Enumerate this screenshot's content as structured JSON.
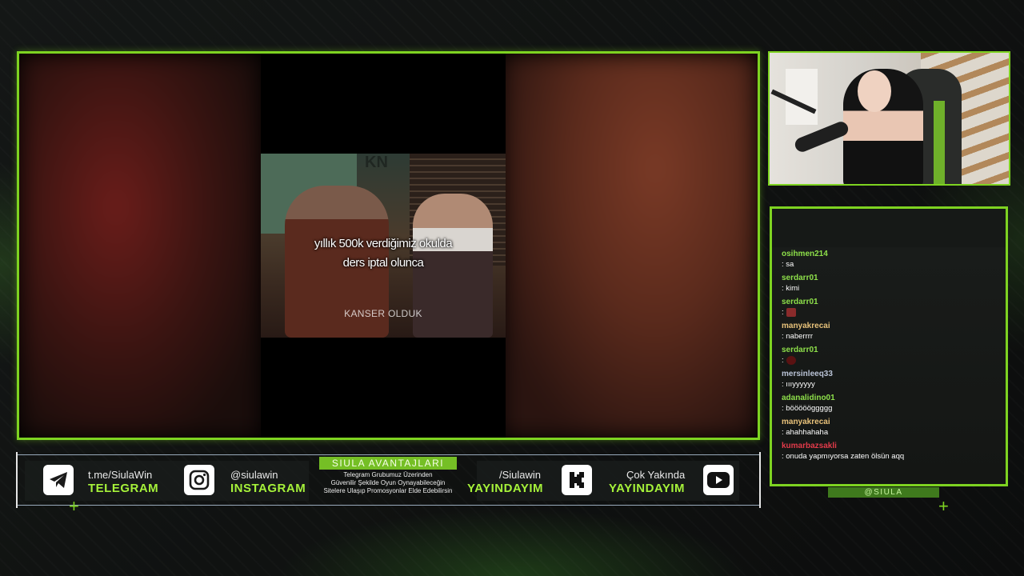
{
  "video": {
    "caption_line1": "yıllık 500k verdiğimiz okulda",
    "caption_line2": "ders iptal olunca",
    "watermark": "KANSER OLDUK",
    "channel_logo": "KN"
  },
  "socials": [
    {
      "icon": "telegram-icon",
      "handle": "t.me/SiulaWin",
      "label": "TELEGRAM"
    },
    {
      "icon": "instagram-icon",
      "handle": "@siulawin",
      "label": "INSTAGRAM"
    },
    {
      "icon": "kick-icon",
      "handle": "/Siulawin",
      "label": "YAYINDAYIM"
    },
    {
      "icon": "youtube-icon",
      "handle": "Çok Yakında",
      "label": "YAYINDAYIM"
    }
  ],
  "advantages": {
    "title": "SIULA AVANTAJLARI",
    "line1": "Telegram Grubumuz Üzerinden",
    "line2": "Güvenilir Şekilde Oyun Oynayabileceğin",
    "line3": "Sitelere Ulaşıp Promosyonlar Elde Edebilirsin"
  },
  "chat": {
    "tag": "@SIULA",
    "messages": [
      {
        "user": "osihmen214",
        "text": ": sa",
        "color": "#8ee04a"
      },
      {
        "user": "serdarr01",
        "text": ": kimi",
        "color": "#8ee04a"
      },
      {
        "user": "serdarr01",
        "text": ":",
        "emote": true,
        "color": "#8ee04a"
      },
      {
        "user": "manyakrecai",
        "text": ": naberrrr",
        "color": "#e8c27a"
      },
      {
        "user": "serdarr01",
        "text": ":",
        "emote": true,
        "color": "#8ee04a"
      },
      {
        "user": "mersinleeq33",
        "text": ": ıııyyyyyy",
        "color": "#b9c3d6"
      },
      {
        "user": "adanalidino01",
        "text": ": böööööggggg",
        "color": "#8ee04a"
      },
      {
        "user": "manyakrecai",
        "text": ": ahahhahaha",
        "color": "#e8c27a"
      },
      {
        "user": "kumarbazsakli",
        "text": ": onuda yapmıyorsa zaten ölsün aqq",
        "color": "#e23a4a"
      }
    ]
  }
}
